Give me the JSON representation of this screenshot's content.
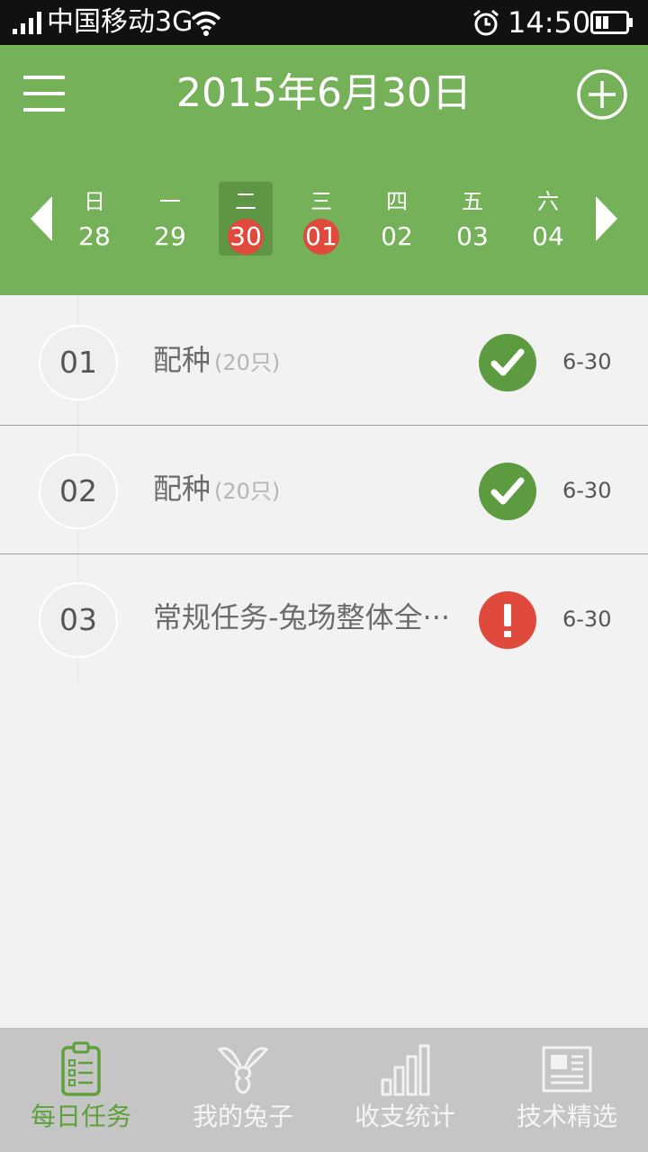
{
  "status_bar": {
    "carrier": "中国移动3G",
    "time": "14:50",
    "icons": [
      "signal-icon",
      "wifi-icon",
      "alarm-icon",
      "battery-icon"
    ]
  },
  "header": {
    "title": "2015年6月30日",
    "menu_icon": "menu-icon",
    "add_icon": "add-circle-icon",
    "colors": {
      "background": "#75b158",
      "selected_day": "#5e9646",
      "marker": "#e04a3c"
    }
  },
  "week": {
    "days": [
      {
        "weekday": "日",
        "date": "28",
        "selected": false,
        "marked": false
      },
      {
        "weekday": "一",
        "date": "29",
        "selected": false,
        "marked": false
      },
      {
        "weekday": "二",
        "date": "30",
        "selected": true,
        "marked": true
      },
      {
        "weekday": "三",
        "date": "01",
        "selected": false,
        "marked": true
      },
      {
        "weekday": "四",
        "date": "02",
        "selected": false,
        "marked": false
      },
      {
        "weekday": "五",
        "date": "03",
        "selected": false,
        "marked": false
      },
      {
        "weekday": "六",
        "date": "04",
        "selected": false,
        "marked": false
      }
    ]
  },
  "tasks": [
    {
      "number": "01",
      "title": "配种",
      "count": "(20只)",
      "status": "done",
      "status_icon": "checkmark-icon",
      "date": "6-30"
    },
    {
      "number": "02",
      "title": "配种",
      "count": "(20只)",
      "status": "done",
      "status_icon": "checkmark-icon",
      "date": "6-30"
    },
    {
      "number": "03",
      "title": "常规任务-兔场整体全···",
      "count": "",
      "status": "warn",
      "status_icon": "exclamation-icon",
      "date": "6-30"
    }
  ],
  "tabs": [
    {
      "label": "每日任务",
      "icon": "clipboard-checklist-icon",
      "active": true
    },
    {
      "label": "我的兔子",
      "icon": "rabbit-icon",
      "active": false
    },
    {
      "label": "收支统计",
      "icon": "bar-chart-icon",
      "active": false
    },
    {
      "label": "技术精选",
      "icon": "newspaper-icon",
      "active": false
    }
  ],
  "colors": {
    "active_tab": "#5fa03d",
    "done": "#5c9b3f",
    "warn": "#e04a3c"
  }
}
